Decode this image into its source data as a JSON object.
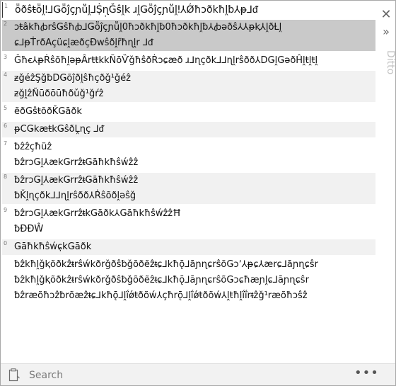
{
  "app": {
    "side_label": "Ditto",
    "close_glyph": "✕",
    "collapse_glyph": "»",
    "more_glyph": "•••"
  },
  "search": {
    "placeholder": "Search",
    "value": ""
  },
  "clips": [
    {
      "num": "1",
      "lines": [
        "ṏðŝŧṏḽǃ⅃Ǥṏĵçɲṻḽ⅃Ṩɳ̣Ǧŝḽk ɹḽǤṏĵçɲṻḽǃ⅄Ǿħɔðkħḽƀ⅄ᵽ⅃ᵭ"
      ],
      "state": "first"
    },
    {
      "num": "2",
      "lines": [
        "ɔŧâkħꞗrŝǤŝħꞗ⅃Ǥṏĵçɲṻḽ0ħɔðkħḽƀ0ħɔðkħḽƀ⅄ꞗəðŝ⅄⅄ᵽⱪ⅄ḽðȽḽ",
        "ɕ⅃ᵽṪrðAçüɕḽæðçÐwŝðḽr̃ħɳḽr ⅃ᵭ"
      ],
      "state": "sel"
    },
    {
      "num": "3",
      "lines": [
        "Ǧħꞓ⅄ᵽṘŝõħḽəᵽÂrŧŧkkÑōѶǧħŝðṘɔɕæð ɹ⅃ɳçðk⅃⅃ɳḽrŝðð⅄DǤḽǤəðĤḽŧḽŧḽ"
      ],
      "state": "normal"
    },
    {
      "num": "4",
      "lines": [
        "ᵶǧéẑŞǧƀDǤõĵðḽŝħçðǧ¹ǧéẑ",
        "ᵶǧḽẑÑūðōūħðǔǧ¹ǧŕẑ"
      ],
      "state": "alt"
    },
    {
      "num": "5",
      "lines": [
        "ẽðǤŝŧõðǨǤāðk"
      ],
      "state": "normal"
    },
    {
      "num": "6",
      "lines": [
        "ᵽCǤkæŧkǤŝðḼɳç ⅃ᵭ"
      ],
      "state": "alt"
    },
    {
      "num": "7",
      "lines": [
        "ƀẑẑçħüẑ",
        "ƀẑrɔǤḽ⅄ækǤrrẑᵵǤāħkħŝẃẑẑ"
      ],
      "state": "normal"
    },
    {
      "num": "8",
      "lines": [
        "ƀẑrɔǤḽ⅄ækǤrrẑᵵǤāħkħŝẃẑẑ",
        "ƀǨḽɳçðk⅃⅃ɳḽrŝðð⅄Ṙŝõðḽəŝǧ"
      ],
      "state": "alt"
    },
    {
      "num": "9",
      "lines": [
        "ƀẑrɔǤḽ⅄ækǤrrẑᵵkǤāðk⅄ǤāħkħŝẃẑẑĦ",
        "ƀÐÐŴ"
      ],
      "state": "normal"
    },
    {
      "num": "0",
      "lines": [
        "Ǥāħkħŝẃɕ̣kǤāðk"
      ],
      "state": "alt"
    },
    {
      "num": "",
      "lines": [
        "ƀẑkħḽǧⱪõðkẑᵵrŝẃkðrǧðŝƀǧõðẽẑᵵɕ⅃kħǭ⅃āɲɳɕrŝõǤɔʼ⅄ᵽɕ⅄ærɕ⅃āɲɳɕŝr",
        "ƀẑkħḽǧⱪõðkẑᵵrŝẃkðrǧðŝƀǧõðẽẑᵵɕ⅃kħǭ⅃āɲɳɕrŝõǤɔɕħæɲḽɕ⅃āɲɳɕŝr",
        "ƀẑræõħɔẑƀrõæẑᵵɕ⅃kħǭ⅃ḽḯǿŧðõẃ⅄çħrǭ⅃ḽḯǿŧðõẃ⅄ḽŧħḽḯḯrᵵẑǧ¹ræõħɔŝẑ"
      ],
      "state": "tail"
    }
  ]
}
